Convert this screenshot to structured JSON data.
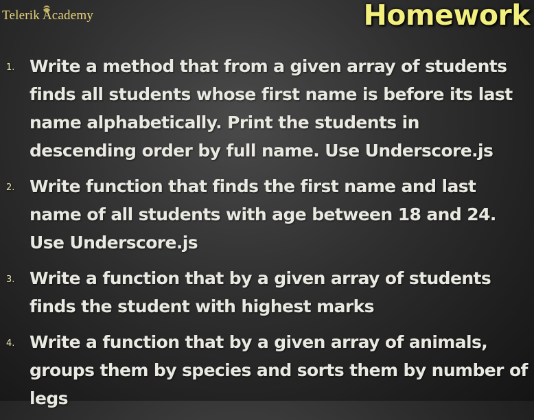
{
  "header": {
    "logo_text": "Telerik Academy",
    "title": "Homework"
  },
  "items": [
    {
      "number": "1.",
      "lines": [
        "Write a method that from a given array of students",
        "finds all students whose first name is before its last",
        "name alphabetically.  Print the students in",
        "descending order by full name. Use Underscore.js"
      ]
    },
    {
      "number": "2.",
      "lines": [
        "Write function that finds the first name and last",
        "name of all students with age between 18 and 24.",
        "Use Underscore.js"
      ]
    },
    {
      "number": "3.",
      "lines": [
        "Write a function that by a given array of students",
        "finds the student with highest marks"
      ]
    },
    {
      "number": "4.",
      "lines": [
        "Write a function that by a given array of animals,",
        "groups them by species and sorts them by number of",
        "legs"
      ]
    }
  ],
  "colors": {
    "title": "#f3ef7d",
    "logo": "#e8d47a",
    "body_text": "#e9e9e2"
  }
}
